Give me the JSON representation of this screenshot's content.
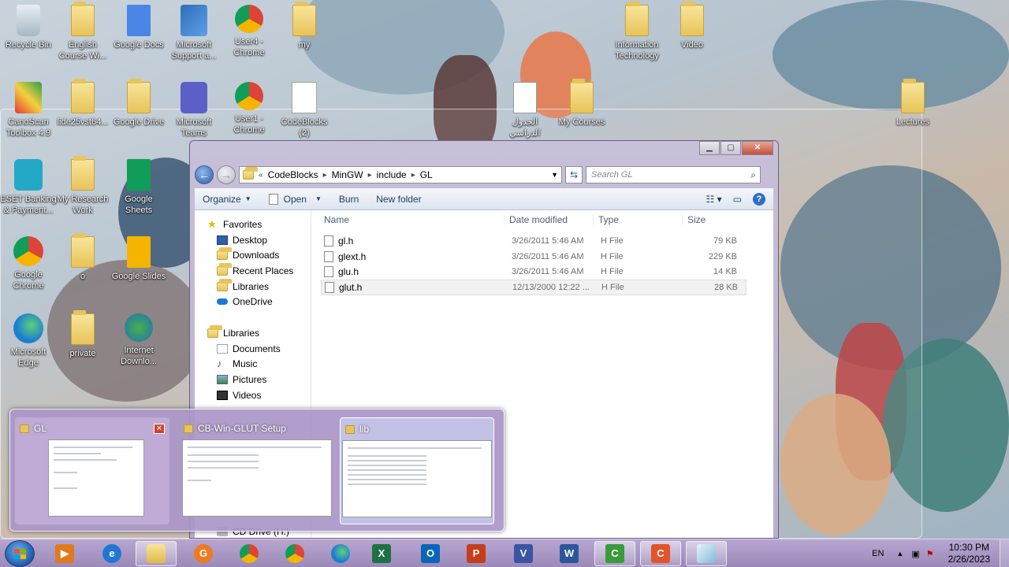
{
  "desktop": {
    "icons": [
      {
        "label": "Recycle Bin",
        "icon": "recycle-bin-icon"
      },
      {
        "label": "English Course Wi...",
        "icon": "folder-icon"
      },
      {
        "label": "Google Docs",
        "icon": "google-docs-icon"
      },
      {
        "label": "Microsoft Support a...",
        "icon": "support-icon"
      },
      {
        "label": "User4 - Chrome",
        "icon": "chrome-icon"
      },
      {
        "label": "my",
        "icon": "folder-icon"
      },
      {
        "label": "Information Technology",
        "icon": "folder-icon"
      },
      {
        "label": "Video",
        "icon": "folder-icon"
      },
      {
        "label": "CanoScan Toolbox 4.9",
        "icon": "canoscan-icon"
      },
      {
        "label": "lide25vst64...",
        "icon": "folder-icon"
      },
      {
        "label": "Google Drive",
        "icon": "folder-icon"
      },
      {
        "label": "Microsoft Teams",
        "icon": "teams-icon"
      },
      {
        "label": "User1 - Chrome",
        "icon": "chrome-icon"
      },
      {
        "label": "CodeBlocks (2)",
        "icon": "codeblocks-icon"
      },
      {
        "label": "الجدول الدراسي",
        "icon": "excel-icon"
      },
      {
        "label": "My Courses",
        "icon": "folder-icon"
      },
      {
        "label": "Lectures",
        "icon": "folder-icon"
      },
      {
        "label": "ESET Banking & Payment...",
        "icon": "eset-icon"
      },
      {
        "label": "My Research Work",
        "icon": "folder-icon"
      },
      {
        "label": "Google Sheets",
        "icon": "google-sheets-icon"
      },
      {
        "label": "Google Chrome",
        "icon": "chrome-icon"
      },
      {
        "label": "o",
        "icon": "folder-icon"
      },
      {
        "label": "Google Slides",
        "icon": "google-slides-icon"
      },
      {
        "label": "Microsoft Edge",
        "icon": "edge-icon"
      },
      {
        "label": "private",
        "icon": "folder-icon"
      },
      {
        "label": "Internet Downlo...",
        "icon": "idm-icon"
      }
    ]
  },
  "explorer": {
    "breadcrumb": [
      "CodeBlocks",
      "MinGW",
      "include",
      "GL"
    ],
    "search_placeholder": "Search GL",
    "toolbar": {
      "organize": "Organize",
      "open": "Open",
      "burn": "Burn",
      "new_folder": "New folder"
    },
    "nav": {
      "favorites_label": "Favorites",
      "favorites": [
        "Desktop",
        "Downloads",
        "Recent Places",
        "Libraries",
        "OneDrive"
      ],
      "libraries_label": "Libraries",
      "libraries": [
        "Documents",
        "Music",
        "Pictures",
        "Videos"
      ],
      "cd_drive": "CD Drive (H:)"
    },
    "columns": {
      "name": "Name",
      "date": "Date modified",
      "type": "Type",
      "size": "Size"
    },
    "files": [
      {
        "name": "gl.h",
        "date": "3/26/2011 5:46 AM",
        "type": "H File",
        "size": "79 KB"
      },
      {
        "name": "glext.h",
        "date": "3/26/2011 5:46 AM",
        "type": "H File",
        "size": "229 KB"
      },
      {
        "name": "glu.h",
        "date": "3/26/2011 5:46 AM",
        "type": "H File",
        "size": "14 KB"
      },
      {
        "name": "glut.h",
        "date": "12/13/2000 12:22 ...",
        "type": "H File",
        "size": "28 KB"
      }
    ]
  },
  "thumbnails": [
    {
      "title": "GL"
    },
    {
      "title": "CB-Win-GLUT Setup"
    },
    {
      "title": "lib"
    }
  ],
  "tray": {
    "lang": "EN",
    "time": "10:30 PM",
    "date": "2/26/2023"
  },
  "colors": {
    "accent": "#2a5ca8",
    "taskbar": "#a898c4"
  }
}
